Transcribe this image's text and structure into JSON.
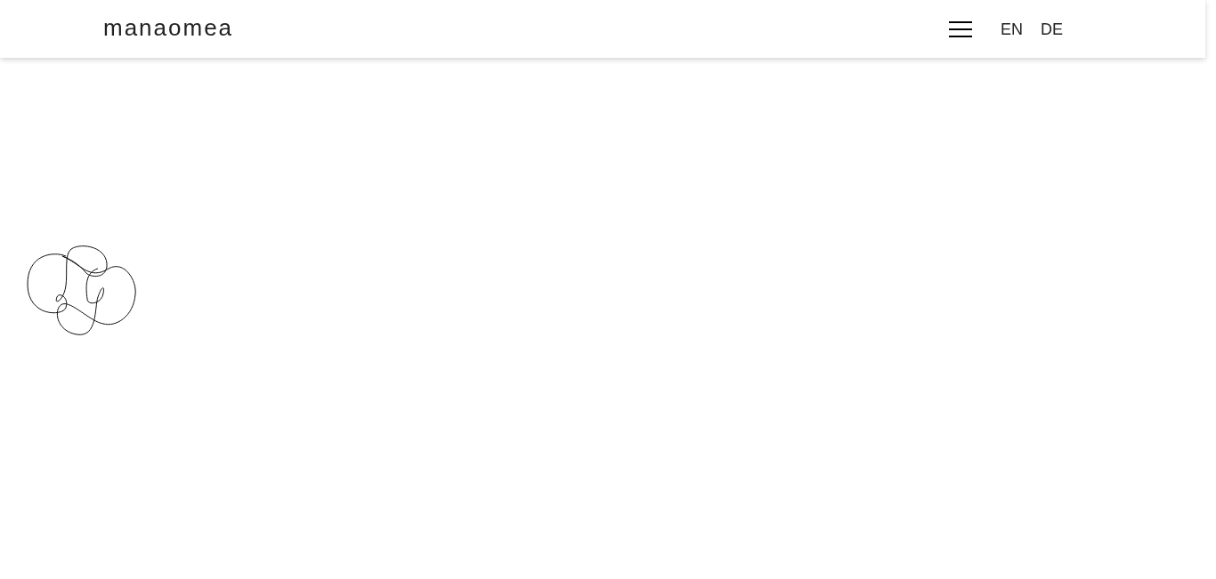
{
  "header": {
    "logo": "manaomea",
    "languages": [
      {
        "label": "EN"
      },
      {
        "label": "DE"
      }
    ]
  }
}
